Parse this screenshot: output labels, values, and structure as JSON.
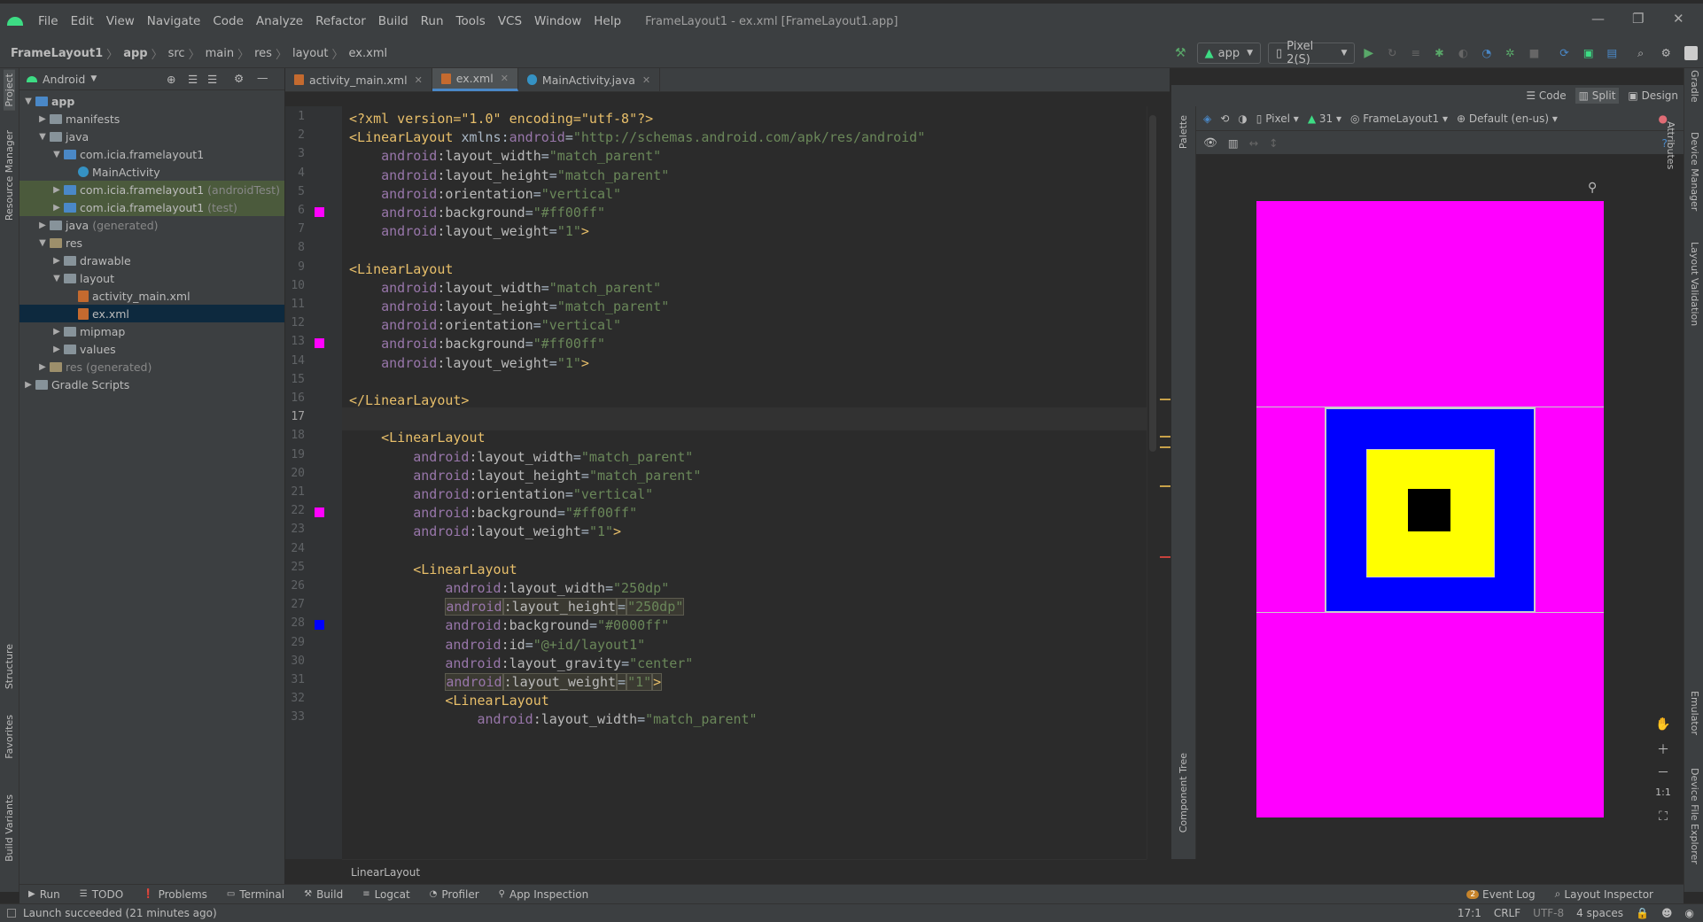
{
  "window": {
    "title": "FrameLayout1 - ex.xml [FrameLayout1.app]"
  },
  "menu": [
    "File",
    "Edit",
    "View",
    "Navigate",
    "Code",
    "Analyze",
    "Refactor",
    "Build",
    "Run",
    "Tools",
    "VCS",
    "Window",
    "Help"
  ],
  "breadcrumb": [
    "FrameLayout1",
    "app",
    "src",
    "main",
    "res",
    "layout",
    "ex.xml"
  ],
  "toolbar": {
    "run_config": "app",
    "device": "Pixel 2(S)"
  },
  "left_strip": {
    "project": "Project",
    "resource_manager": "Resource Manager",
    "structure": "Structure",
    "favorites": "Favorites",
    "build_variants": "Build Variants"
  },
  "right_strip": {
    "gradle": "Gradle",
    "device_manager": "Device Manager",
    "layout_validation": "Layout Validation",
    "emulator": "Emulator",
    "device_file_explorer": "Device File Explorer"
  },
  "project": {
    "view": "Android",
    "tree": [
      {
        "label": "app",
        "level": 0,
        "type": "module",
        "bold": true
      },
      {
        "label": "manifests",
        "level": 1,
        "type": "folder"
      },
      {
        "label": "java",
        "level": 1,
        "type": "folder"
      },
      {
        "label": "com.icia.framelayout1",
        "level": 2,
        "type": "pkg"
      },
      {
        "label": "MainActivity",
        "level": 3,
        "type": "class"
      },
      {
        "label": "com.icia.framelayout1",
        "suffix": "(androidTest)",
        "level": 2,
        "type": "pkg",
        "hl": true
      },
      {
        "label": "com.icia.framelayout1",
        "suffix": "(test)",
        "level": 2,
        "type": "pkg",
        "hl": true
      },
      {
        "label": "java",
        "suffix": "(generated)",
        "level": 1,
        "type": "folder"
      },
      {
        "label": "res",
        "level": 1,
        "type": "res"
      },
      {
        "label": "drawable",
        "level": 2,
        "type": "folder"
      },
      {
        "label": "layout",
        "level": 2,
        "type": "folder"
      },
      {
        "label": "activity_main.xml",
        "level": 3,
        "type": "xml"
      },
      {
        "label": "ex.xml",
        "level": 3,
        "type": "xml",
        "sel": true
      },
      {
        "label": "mipmap",
        "level": 2,
        "type": "folder"
      },
      {
        "label": "values",
        "level": 2,
        "type": "folder"
      },
      {
        "label": "res (generated)",
        "level": 1,
        "type": "res"
      },
      {
        "label": "Gradle Scripts",
        "level": 0,
        "type": "gradle"
      }
    ]
  },
  "tabs": [
    {
      "label": "activity_main.xml"
    },
    {
      "label": "ex.xml",
      "active": true
    },
    {
      "label": "MainActivity.java"
    }
  ],
  "view_modes": {
    "code": "Code",
    "split": "Split",
    "design": "Design"
  },
  "inspections": {
    "errors": "1",
    "warnings": "4"
  },
  "editor": {
    "current_line": 17,
    "lines": [
      {
        "n": 1,
        "parts": [
          [
            "tg",
            "<?xml version=\"1.0\" encoding=\"utf-8\"?>"
          ]
        ]
      },
      {
        "n": 2,
        "parts": [
          [
            "tg",
            "<LinearLayout "
          ],
          [
            "pl",
            "xmlns:"
          ],
          [
            "ns",
            "android"
          ],
          [
            "pl",
            "="
          ],
          [
            "av",
            "\"http://schemas.android.com/apk/res/android\""
          ]
        ]
      },
      {
        "n": 3,
        "parts": [
          [
            "pl",
            "    "
          ],
          [
            "ns",
            "android"
          ],
          [
            "at",
            ":layout_width"
          ],
          [
            "pl",
            "="
          ],
          [
            "av",
            "\"match_parent\""
          ]
        ]
      },
      {
        "n": 4,
        "parts": [
          [
            "pl",
            "    "
          ],
          [
            "ns",
            "android"
          ],
          [
            "at",
            ":layout_height"
          ],
          [
            "pl",
            "="
          ],
          [
            "av",
            "\"match_parent\""
          ]
        ]
      },
      {
        "n": 5,
        "parts": [
          [
            "pl",
            "    "
          ],
          [
            "ns",
            "android"
          ],
          [
            "at",
            ":orientation"
          ],
          [
            "pl",
            "="
          ],
          [
            "av",
            "\"vertical\""
          ]
        ]
      },
      {
        "n": 6,
        "swatch": "#ff00ff",
        "parts": [
          [
            "pl",
            "    "
          ],
          [
            "ns",
            "android"
          ],
          [
            "at",
            ":background"
          ],
          [
            "pl",
            "="
          ],
          [
            "av",
            "\"#ff00ff\""
          ]
        ]
      },
      {
        "n": 7,
        "parts": [
          [
            "pl",
            "    "
          ],
          [
            "ns",
            "android"
          ],
          [
            "at",
            ":layout_weight"
          ],
          [
            "pl",
            "="
          ],
          [
            "av",
            "\"1\""
          ],
          [
            "tg",
            ">"
          ]
        ]
      },
      {
        "n": 8,
        "parts": []
      },
      {
        "n": 9,
        "parts": [
          [
            "tg",
            "<LinearLayout"
          ]
        ]
      },
      {
        "n": 10,
        "parts": [
          [
            "pl",
            "    "
          ],
          [
            "ns",
            "android"
          ],
          [
            "at",
            ":layout_width"
          ],
          [
            "pl",
            "="
          ],
          [
            "av",
            "\"match_parent\""
          ]
        ]
      },
      {
        "n": 11,
        "parts": [
          [
            "pl",
            "    "
          ],
          [
            "ns",
            "android"
          ],
          [
            "at",
            ":layout_height"
          ],
          [
            "pl",
            "="
          ],
          [
            "av",
            "\"match_parent\""
          ]
        ]
      },
      {
        "n": 12,
        "parts": [
          [
            "pl",
            "    "
          ],
          [
            "ns",
            "android"
          ],
          [
            "at",
            ":orientation"
          ],
          [
            "pl",
            "="
          ],
          [
            "av",
            "\"vertical\""
          ]
        ]
      },
      {
        "n": 13,
        "swatch": "#ff00ff",
        "parts": [
          [
            "pl",
            "    "
          ],
          [
            "ns",
            "android"
          ],
          [
            "at",
            ":background"
          ],
          [
            "pl",
            "="
          ],
          [
            "av",
            "\"#ff00ff\""
          ]
        ]
      },
      {
        "n": 14,
        "parts": [
          [
            "pl",
            "    "
          ],
          [
            "ns",
            "android"
          ],
          [
            "at",
            ":layout_weight"
          ],
          [
            "pl",
            "="
          ],
          [
            "av",
            "\"1\""
          ],
          [
            "tg",
            ">"
          ]
        ]
      },
      {
        "n": 15,
        "parts": []
      },
      {
        "n": 16,
        "parts": [
          [
            "tg",
            "</LinearLayout>"
          ]
        ]
      },
      {
        "n": 17,
        "parts": []
      },
      {
        "n": 18,
        "parts": [
          [
            "pl",
            "    "
          ],
          [
            "tg",
            "<LinearLayout"
          ]
        ]
      },
      {
        "n": 19,
        "parts": [
          [
            "pl",
            "        "
          ],
          [
            "ns",
            "android"
          ],
          [
            "at",
            ":layout_width"
          ],
          [
            "pl",
            "="
          ],
          [
            "av",
            "\"match_parent\""
          ]
        ]
      },
      {
        "n": 20,
        "parts": [
          [
            "pl",
            "        "
          ],
          [
            "ns",
            "android"
          ],
          [
            "at",
            ":layout_height"
          ],
          [
            "pl",
            "="
          ],
          [
            "av",
            "\"match_parent\""
          ]
        ]
      },
      {
        "n": 21,
        "parts": [
          [
            "pl",
            "        "
          ],
          [
            "ns",
            "android"
          ],
          [
            "at",
            ":orientation"
          ],
          [
            "pl",
            "="
          ],
          [
            "av",
            "\"vertical\""
          ]
        ]
      },
      {
        "n": 22,
        "swatch": "#ff00ff",
        "parts": [
          [
            "pl",
            "        "
          ],
          [
            "ns",
            "android"
          ],
          [
            "at",
            ":background"
          ],
          [
            "pl",
            "="
          ],
          [
            "av",
            "\"#ff00ff\""
          ]
        ]
      },
      {
        "n": 23,
        "parts": [
          [
            "pl",
            "        "
          ],
          [
            "ns",
            "android"
          ],
          [
            "at",
            ":layout_weight"
          ],
          [
            "pl",
            "="
          ],
          [
            "av",
            "\"1\""
          ],
          [
            "tg",
            ">"
          ]
        ]
      },
      {
        "n": 24,
        "parts": []
      },
      {
        "n": 25,
        "parts": [
          [
            "pl",
            "        "
          ],
          [
            "tg",
            "<LinearLayout"
          ]
        ]
      },
      {
        "n": 26,
        "parts": [
          [
            "pl",
            "            "
          ],
          [
            "ns",
            "android"
          ],
          [
            "at",
            ":layout_width"
          ],
          [
            "pl",
            "="
          ],
          [
            "av",
            "\"250dp\""
          ]
        ]
      },
      {
        "n": 27,
        "hl": true,
        "parts": [
          [
            "pl",
            "            "
          ],
          [
            "ns",
            "android"
          ],
          [
            "at",
            ":layout_height"
          ],
          [
            "pl",
            "="
          ],
          [
            "av",
            "\"250dp\""
          ]
        ]
      },
      {
        "n": 28,
        "swatch": "#0000ff",
        "parts": [
          [
            "pl",
            "            "
          ],
          [
            "ns",
            "android"
          ],
          [
            "at",
            ":background"
          ],
          [
            "pl",
            "="
          ],
          [
            "av",
            "\"#0000ff\""
          ]
        ]
      },
      {
        "n": 29,
        "parts": [
          [
            "pl",
            "            "
          ],
          [
            "ns",
            "android"
          ],
          [
            "at",
            ":id"
          ],
          [
            "pl",
            "="
          ],
          [
            "av",
            "\"@+id/layout1\""
          ]
        ]
      },
      {
        "n": 30,
        "parts": [
          [
            "pl",
            "            "
          ],
          [
            "ns",
            "android"
          ],
          [
            "at",
            ":layout_gravity"
          ],
          [
            "pl",
            "="
          ],
          [
            "av",
            "\"center\""
          ]
        ]
      },
      {
        "n": 31,
        "hl": true,
        "parts": [
          [
            "pl",
            "            "
          ],
          [
            "ns",
            "android"
          ],
          [
            "at",
            ":layout_weight"
          ],
          [
            "pl",
            "="
          ],
          [
            "av",
            "\"1\""
          ],
          [
            "tg",
            ">"
          ]
        ]
      },
      {
        "n": 32,
        "parts": [
          [
            "pl",
            "            "
          ],
          [
            "tg",
            "<LinearLayout"
          ]
        ]
      },
      {
        "n": 33,
        "parts": [
          [
            "pl",
            "                "
          ],
          [
            "ns",
            "android"
          ],
          [
            "at",
            ":layout_width"
          ],
          [
            "pl",
            "="
          ],
          [
            "av",
            "\"match_parent\""
          ]
        ]
      }
    ],
    "breadcrumb": "LinearLayout"
  },
  "design": {
    "device": "Pixel",
    "api": "31",
    "theme": "FrameLayout1",
    "locale": "Default (en-us)",
    "palette": "Palette",
    "attributes": "Attributes",
    "component_tree": "Component Tree",
    "zoom_fit": "1:1",
    "colors": {
      "outer": "#ff00ff",
      "middle": "#0000ff",
      "inner": "#ffff00",
      "core": "#000000"
    }
  },
  "bottom_tools": [
    "Run",
    "TODO",
    "Problems",
    "Terminal",
    "Build",
    "Logcat",
    "Profiler",
    "App Inspection"
  ],
  "bottom_right": [
    "Event Log",
    "Layout Inspector"
  ],
  "event_count": "2",
  "status": {
    "message": "Launch succeeded (21 minutes ago)",
    "position": "17:1",
    "line_sep": "CRLF",
    "encoding": "UTF-8",
    "indent": "4 spaces"
  }
}
